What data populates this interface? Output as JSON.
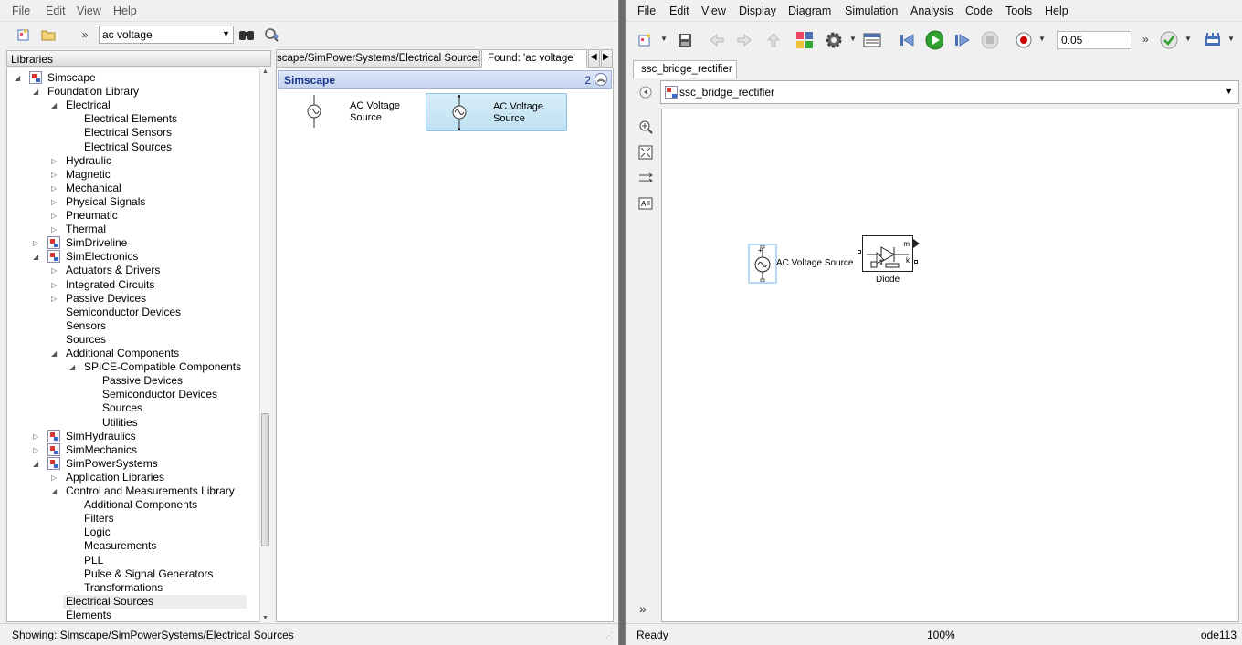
{
  "library_browser": {
    "menu": [
      "File",
      "Edit",
      "View",
      "Help"
    ],
    "search_value": "ac voltage",
    "panel_title": "Libraries",
    "tree": [
      {
        "label": "Simscape",
        "level": 0,
        "state": "open",
        "lib": true
      },
      {
        "label": "Foundation Library",
        "level": 1,
        "state": "open",
        "lib": false
      },
      {
        "label": "Electrical",
        "level": 2,
        "state": "open",
        "lib": false
      },
      {
        "label": "Electrical Elements",
        "level": 3,
        "state": "leaf",
        "lib": false
      },
      {
        "label": "Electrical Sensors",
        "level": 3,
        "state": "leaf",
        "lib": false
      },
      {
        "label": "Electrical Sources",
        "level": 3,
        "state": "leaf",
        "lib": false
      },
      {
        "label": "Hydraulic",
        "level": 2,
        "state": "closed",
        "lib": false
      },
      {
        "label": "Magnetic",
        "level": 2,
        "state": "closed",
        "lib": false
      },
      {
        "label": "Mechanical",
        "level": 2,
        "state": "closed",
        "lib": false
      },
      {
        "label": "Physical Signals",
        "level": 2,
        "state": "closed",
        "lib": false
      },
      {
        "label": "Pneumatic",
        "level": 2,
        "state": "closed",
        "lib": false
      },
      {
        "label": "Thermal",
        "level": 2,
        "state": "closed",
        "lib": false
      },
      {
        "label": "SimDriveline",
        "level": 1,
        "state": "closed",
        "lib": true
      },
      {
        "label": "SimElectronics",
        "level": 1,
        "state": "open",
        "lib": true
      },
      {
        "label": "Actuators & Drivers",
        "level": 2,
        "state": "closed",
        "lib": false
      },
      {
        "label": "Integrated Circuits",
        "level": 2,
        "state": "closed",
        "lib": false
      },
      {
        "label": "Passive Devices",
        "level": 2,
        "state": "closed",
        "lib": false
      },
      {
        "label": "Semiconductor Devices",
        "level": 2,
        "state": "leaf",
        "lib": false
      },
      {
        "label": "Sensors",
        "level": 2,
        "state": "leaf",
        "lib": false
      },
      {
        "label": "Sources",
        "level": 2,
        "state": "leaf",
        "lib": false
      },
      {
        "label": "Additional Components",
        "level": 2,
        "state": "open",
        "lib": false
      },
      {
        "label": "SPICE-Compatible Components",
        "level": 3,
        "state": "open",
        "lib": false
      },
      {
        "label": "Passive Devices",
        "level": 4,
        "state": "leaf",
        "lib": false
      },
      {
        "label": "Semiconductor Devices",
        "level": 4,
        "state": "leaf",
        "lib": false
      },
      {
        "label": "Sources",
        "level": 4,
        "state": "leaf",
        "lib": false
      },
      {
        "label": "Utilities",
        "level": 4,
        "state": "leaf",
        "lib": false
      },
      {
        "label": "SimHydraulics",
        "level": 1,
        "state": "closed",
        "lib": true
      },
      {
        "label": "SimMechanics",
        "level": 1,
        "state": "closed",
        "lib": true
      },
      {
        "label": "SimPowerSystems",
        "level": 1,
        "state": "open",
        "lib": true
      },
      {
        "label": "Application Libraries",
        "level": 2,
        "state": "closed",
        "lib": false
      },
      {
        "label": "Control and  Measurements Library",
        "level": 2,
        "state": "open",
        "lib": false
      },
      {
        "label": "Additional Components",
        "level": 3,
        "state": "leaf",
        "lib": false
      },
      {
        "label": "Filters",
        "level": 3,
        "state": "leaf",
        "lib": false
      },
      {
        "label": "Logic",
        "level": 3,
        "state": "leaf",
        "lib": false
      },
      {
        "label": "Measurements",
        "level": 3,
        "state": "leaf",
        "lib": false
      },
      {
        "label": "PLL",
        "level": 3,
        "state": "leaf",
        "lib": false
      },
      {
        "label": "Pulse & Signal Generators",
        "level": 3,
        "state": "leaf",
        "lib": false
      },
      {
        "label": "Transformations",
        "level": 3,
        "state": "leaf",
        "lib": false
      },
      {
        "label": "Electrical Sources",
        "level": 2,
        "state": "leaf",
        "lib": false,
        "selected": true
      },
      {
        "label": "Elements",
        "level": 2,
        "state": "leaf",
        "lib": false
      }
    ],
    "tabs": [
      "scape/SimPowerSystems/Electrical Sources",
      "Found: 'ac voltage'"
    ],
    "group_title": "Simscape",
    "group_count": "2",
    "blocks": [
      {
        "label_line1": "AC Voltage",
        "label_line2": "Source"
      },
      {
        "label_line1": "AC Voltage",
        "label_line2": "Source"
      }
    ],
    "status_text": "Showing: Simscape/SimPowerSystems/Electrical Sources"
  },
  "model_editor": {
    "menu": [
      "File",
      "Edit",
      "View",
      "Display",
      "Diagram",
      "Simulation",
      "Analysis",
      "Code",
      "Tools",
      "Help"
    ],
    "stop_time": "0.05",
    "model_tab": "ssc_bridge_rectifier",
    "address": "ssc_bridge_rectifier",
    "canvas": {
      "source_label": "AC Voltage Source",
      "diode_label": "Diode",
      "port_m": "m",
      "port_k": "k",
      "port_plus": "+"
    },
    "status": {
      "left": "Ready",
      "zoom": "100%",
      "solver": "ode113"
    }
  },
  "colors": {
    "selection": "#cfe6f6",
    "group_header": "#c5d3ef",
    "run_green": "#2fa12f"
  }
}
